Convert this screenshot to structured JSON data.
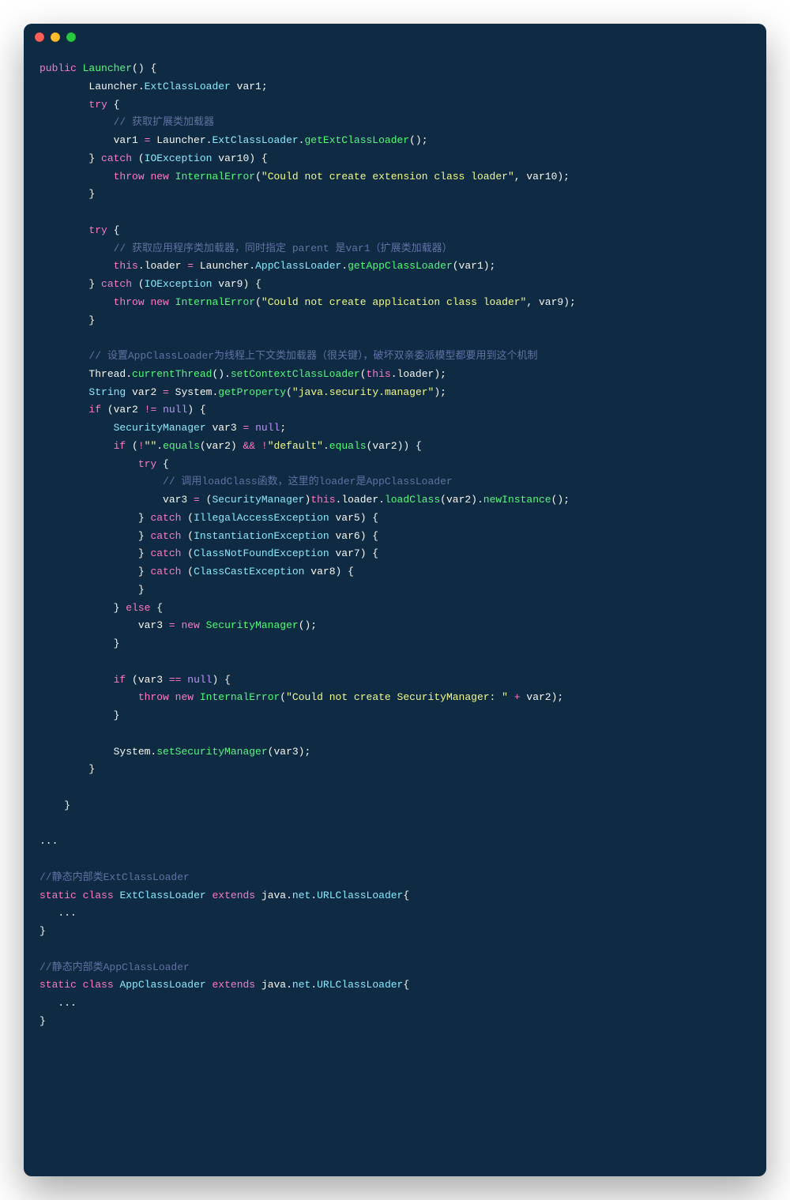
{
  "window": {
    "traffic_lights": [
      "close",
      "minimize",
      "zoom"
    ]
  },
  "code": {
    "lines": [
      [
        [
          "kw",
          "public"
        ],
        [
          "plain",
          " "
        ],
        [
          "fn",
          "Launcher"
        ],
        [
          "plain",
          "() {"
        ]
      ],
      [
        [
          "plain",
          "        Launcher."
        ],
        [
          "type",
          "ExtClassLoader"
        ],
        [
          "plain",
          " var1;"
        ]
      ],
      [
        [
          "plain",
          "        "
        ],
        [
          "kw",
          "try"
        ],
        [
          "plain",
          " {"
        ]
      ],
      [
        [
          "plain",
          "            "
        ],
        [
          "cmt",
          "// 获取扩展类加载器"
        ]
      ],
      [
        [
          "plain",
          "            var1 "
        ],
        [
          "op",
          "="
        ],
        [
          "plain",
          " Launcher."
        ],
        [
          "type",
          "ExtClassLoader"
        ],
        [
          "plain",
          "."
        ],
        [
          "fn",
          "getExtClassLoader"
        ],
        [
          "plain",
          "();"
        ]
      ],
      [
        [
          "plain",
          "        } "
        ],
        [
          "kw",
          "catch"
        ],
        [
          "plain",
          " ("
        ],
        [
          "type",
          "IOException"
        ],
        [
          "plain",
          " var10) {"
        ]
      ],
      [
        [
          "plain",
          "            "
        ],
        [
          "kw",
          "throw"
        ],
        [
          "plain",
          " "
        ],
        [
          "kw",
          "new"
        ],
        [
          "plain",
          " "
        ],
        [
          "fn",
          "InternalError"
        ],
        [
          "plain",
          "("
        ],
        [
          "str",
          "\"Could not create extension class loader\""
        ],
        [
          "plain",
          ", var10);"
        ]
      ],
      [
        [
          "plain",
          "        }"
        ]
      ],
      [
        [
          "plain",
          ""
        ]
      ],
      [
        [
          "plain",
          "        "
        ],
        [
          "kw",
          "try"
        ],
        [
          "plain",
          " {"
        ]
      ],
      [
        [
          "plain",
          "            "
        ],
        [
          "cmt",
          "// 获取应用程序类加载器，同时指定 parent 是var1（扩展类加载器）"
        ]
      ],
      [
        [
          "plain",
          "            "
        ],
        [
          "kw",
          "this"
        ],
        [
          "plain",
          ".loader "
        ],
        [
          "op",
          "="
        ],
        [
          "plain",
          " Launcher."
        ],
        [
          "type",
          "AppClassLoader"
        ],
        [
          "plain",
          "."
        ],
        [
          "fn",
          "getAppClassLoader"
        ],
        [
          "plain",
          "(var1);"
        ]
      ],
      [
        [
          "plain",
          "        } "
        ],
        [
          "kw",
          "catch"
        ],
        [
          "plain",
          " ("
        ],
        [
          "type",
          "IOException"
        ],
        [
          "plain",
          " var9) {"
        ]
      ],
      [
        [
          "plain",
          "            "
        ],
        [
          "kw",
          "throw"
        ],
        [
          "plain",
          " "
        ],
        [
          "kw",
          "new"
        ],
        [
          "plain",
          " "
        ],
        [
          "fn",
          "InternalError"
        ],
        [
          "plain",
          "("
        ],
        [
          "str",
          "\"Could not create application class loader\""
        ],
        [
          "plain",
          ", var9);"
        ]
      ],
      [
        [
          "plain",
          "        }"
        ]
      ],
      [
        [
          "plain",
          ""
        ]
      ],
      [
        [
          "plain",
          "        "
        ],
        [
          "cmt",
          "// 设置AppClassLoader为线程上下文类加载器（很关键），破坏双亲委派模型都要用到这个机制"
        ]
      ],
      [
        [
          "plain",
          "        Thread."
        ],
        [
          "fn",
          "currentThread"
        ],
        [
          "plain",
          "()."
        ],
        [
          "fn",
          "setContextClassLoader"
        ],
        [
          "plain",
          "("
        ],
        [
          "kw",
          "this"
        ],
        [
          "plain",
          ".loader);"
        ]
      ],
      [
        [
          "plain",
          "        "
        ],
        [
          "type",
          "String"
        ],
        [
          "plain",
          " var2 "
        ],
        [
          "op",
          "="
        ],
        [
          "plain",
          " System."
        ],
        [
          "fn",
          "getProperty"
        ],
        [
          "plain",
          "("
        ],
        [
          "str",
          "\"java.security.manager\""
        ],
        [
          "plain",
          ");"
        ]
      ],
      [
        [
          "plain",
          "        "
        ],
        [
          "kw",
          "if"
        ],
        [
          "plain",
          " (var2 "
        ],
        [
          "op",
          "!="
        ],
        [
          "plain",
          " "
        ],
        [
          "num",
          "null"
        ],
        [
          "plain",
          ") {"
        ]
      ],
      [
        [
          "plain",
          "            "
        ],
        [
          "type",
          "SecurityManager"
        ],
        [
          "plain",
          " var3 "
        ],
        [
          "op",
          "="
        ],
        [
          "plain",
          " "
        ],
        [
          "num",
          "null"
        ],
        [
          "plain",
          ";"
        ]
      ],
      [
        [
          "plain",
          "            "
        ],
        [
          "kw",
          "if"
        ],
        [
          "plain",
          " ("
        ],
        [
          "op",
          "!"
        ],
        [
          "str",
          "\"\""
        ],
        [
          "plain",
          "."
        ],
        [
          "fn",
          "equals"
        ],
        [
          "plain",
          "(var2) "
        ],
        [
          "op",
          "&&"
        ],
        [
          "plain",
          " "
        ],
        [
          "op",
          "!"
        ],
        [
          "str",
          "\"default\""
        ],
        [
          "plain",
          "."
        ],
        [
          "fn",
          "equals"
        ],
        [
          "plain",
          "(var2)) {"
        ]
      ],
      [
        [
          "plain",
          "                "
        ],
        [
          "kw",
          "try"
        ],
        [
          "plain",
          " {"
        ]
      ],
      [
        [
          "plain",
          "                    "
        ],
        [
          "cmt",
          "// 调用loadClass函数，这里的loader是AppClassLoader"
        ]
      ],
      [
        [
          "plain",
          "                    var3 "
        ],
        [
          "op",
          "="
        ],
        [
          "plain",
          " ("
        ],
        [
          "type",
          "SecurityManager"
        ],
        [
          "plain",
          ")"
        ],
        [
          "kw",
          "this"
        ],
        [
          "plain",
          ".loader."
        ],
        [
          "fn",
          "loadClass"
        ],
        [
          "plain",
          "(var2)."
        ],
        [
          "fn",
          "newInstance"
        ],
        [
          "plain",
          "();"
        ]
      ],
      [
        [
          "plain",
          "                } "
        ],
        [
          "kw",
          "catch"
        ],
        [
          "plain",
          " ("
        ],
        [
          "type",
          "IllegalAccessException"
        ],
        [
          "plain",
          " var5) {"
        ]
      ],
      [
        [
          "plain",
          "                } "
        ],
        [
          "kw",
          "catch"
        ],
        [
          "plain",
          " ("
        ],
        [
          "type",
          "InstantiationException"
        ],
        [
          "plain",
          " var6) {"
        ]
      ],
      [
        [
          "plain",
          "                } "
        ],
        [
          "kw",
          "catch"
        ],
        [
          "plain",
          " ("
        ],
        [
          "type",
          "ClassNotFoundException"
        ],
        [
          "plain",
          " var7) {"
        ]
      ],
      [
        [
          "plain",
          "                } "
        ],
        [
          "kw",
          "catch"
        ],
        [
          "plain",
          " ("
        ],
        [
          "type",
          "ClassCastException"
        ],
        [
          "plain",
          " var8) {"
        ]
      ],
      [
        [
          "plain",
          "                }"
        ]
      ],
      [
        [
          "plain",
          "            } "
        ],
        [
          "kw",
          "else"
        ],
        [
          "plain",
          " {"
        ]
      ],
      [
        [
          "plain",
          "                var3 "
        ],
        [
          "op",
          "="
        ],
        [
          "plain",
          " "
        ],
        [
          "kw",
          "new"
        ],
        [
          "plain",
          " "
        ],
        [
          "fn",
          "SecurityManager"
        ],
        [
          "plain",
          "();"
        ]
      ],
      [
        [
          "plain",
          "            }"
        ]
      ],
      [
        [
          "plain",
          ""
        ]
      ],
      [
        [
          "plain",
          "            "
        ],
        [
          "kw",
          "if"
        ],
        [
          "plain",
          " (var3 "
        ],
        [
          "op",
          "=="
        ],
        [
          "plain",
          " "
        ],
        [
          "num",
          "null"
        ],
        [
          "plain",
          ") {"
        ]
      ],
      [
        [
          "plain",
          "                "
        ],
        [
          "kw",
          "throw"
        ],
        [
          "plain",
          " "
        ],
        [
          "kw",
          "new"
        ],
        [
          "plain",
          " "
        ],
        [
          "fn",
          "InternalError"
        ],
        [
          "plain",
          "("
        ],
        [
          "str",
          "\"Could not create SecurityManager: \""
        ],
        [
          "plain",
          " "
        ],
        [
          "op",
          "+"
        ],
        [
          "plain",
          " var2);"
        ]
      ],
      [
        [
          "plain",
          "            }"
        ]
      ],
      [
        [
          "plain",
          ""
        ]
      ],
      [
        [
          "plain",
          "            System."
        ],
        [
          "fn",
          "setSecurityManager"
        ],
        [
          "plain",
          "(var3);"
        ]
      ],
      [
        [
          "plain",
          "        }"
        ]
      ],
      [
        [
          "plain",
          ""
        ]
      ],
      [
        [
          "plain",
          "    }"
        ]
      ],
      [
        [
          "plain",
          ""
        ]
      ],
      [
        [
          "plain",
          "..."
        ]
      ],
      [
        [
          "plain",
          ""
        ]
      ],
      [
        [
          "cmt",
          "//静态内部类ExtClassLoader"
        ]
      ],
      [
        [
          "kw",
          "static"
        ],
        [
          "plain",
          " "
        ],
        [
          "kw",
          "class"
        ],
        [
          "plain",
          " "
        ],
        [
          "type",
          "ExtClassLoader"
        ],
        [
          "plain",
          " "
        ],
        [
          "kw",
          "extends"
        ],
        [
          "plain",
          " java."
        ],
        [
          "type",
          "net"
        ],
        [
          "plain",
          "."
        ],
        [
          "type",
          "URLClassLoader"
        ],
        [
          "plain",
          "{"
        ]
      ],
      [
        [
          "plain",
          "   ..."
        ]
      ],
      [
        [
          "plain",
          "}"
        ]
      ],
      [
        [
          "plain",
          ""
        ]
      ],
      [
        [
          "cmt",
          "//静态内部类AppClassLoader"
        ]
      ],
      [
        [
          "kw",
          "static"
        ],
        [
          "plain",
          " "
        ],
        [
          "kw",
          "class"
        ],
        [
          "plain",
          " "
        ],
        [
          "type",
          "AppClassLoader"
        ],
        [
          "plain",
          " "
        ],
        [
          "kw",
          "extends"
        ],
        [
          "plain",
          " java."
        ],
        [
          "type",
          "net"
        ],
        [
          "plain",
          "."
        ],
        [
          "type",
          "URLClassLoader"
        ],
        [
          "plain",
          "{"
        ]
      ],
      [
        [
          "plain",
          "   ..."
        ]
      ],
      [
        [
          "plain",
          "}"
        ]
      ]
    ]
  }
}
